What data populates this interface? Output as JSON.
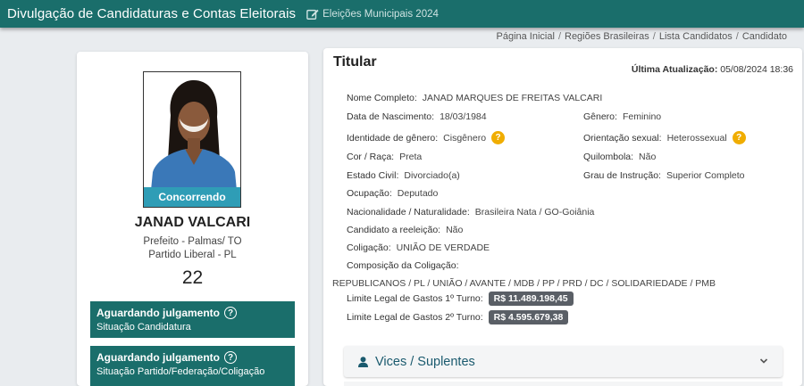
{
  "header": {
    "title": "Divulgação de Candidaturas e Contas Eleitorais",
    "election": "Eleições Municipais 2024"
  },
  "breadcrumb": [
    "Página Inicial",
    "Regiões Brasileiras",
    "Lista Candidatos",
    "Candidato"
  ],
  "candidate": {
    "photo_badge": "Concorrendo",
    "name": "JANAD VALCARI",
    "office": "Prefeito - Palmas/ TO",
    "party": "Partido Liberal - PL",
    "number": "22",
    "status": [
      {
        "title": "Aguardando julgamento",
        "subtitle": "Situação Candidatura"
      },
      {
        "title": "Aguardando julgamento",
        "subtitle": "Situação Partido/Federação/Coligação"
      }
    ]
  },
  "details": {
    "heading": "Titular",
    "updated_label": "Última Atualização:",
    "updated_value": "05/08/2024 18:36",
    "full_name": {
      "label": "Nome Completo:",
      "value": "JANAD MARQUES DE FREITAS VALCARI"
    },
    "birth": {
      "label": "Data de Nascimento:",
      "value": "18/03/1984"
    },
    "gender": {
      "label": "Gênero:",
      "value": "Feminino"
    },
    "gender_identity": {
      "label": "Identidade de gênero:",
      "value": "Cisgênero"
    },
    "sexual_orientation": {
      "label": "Orientação sexual:",
      "value": "Heterossexual"
    },
    "race": {
      "label": "Cor / Raça:",
      "value": "Preta"
    },
    "quilombola": {
      "label": "Quilombola:",
      "value": "Não"
    },
    "civil_status": {
      "label": "Estado Civil:",
      "value": "Divorciado(a)"
    },
    "education": {
      "label": "Grau de Instrução:",
      "value": "Superior Completo"
    },
    "occupation": {
      "label": "Ocupação:",
      "value": "Deputado"
    },
    "nationality": {
      "label": "Nacionalidade / Naturalidade:",
      "value": "Brasileira Nata / GO-Goiânia"
    },
    "reelection": {
      "label": "Candidato a reeleição:",
      "value": "Não"
    },
    "coalition": {
      "label": "Coligação:",
      "value": "UNIÃO DE VERDADE"
    },
    "coalition_comp": {
      "label": "Composição da Coligação:",
      "value": "REPUBLICANOS / PL / UNIÃO / AVANTE / MDB / PP / PRD / DC / SOLIDARIEDADE / PMB"
    },
    "spend_limit_1": {
      "label": "Limite Legal de Gastos 1º Turno:",
      "value": "R$ 11.489.198,45"
    },
    "spend_limit_2": {
      "label": "Limite Legal de Gastos 2º Turno:",
      "value": "R$ 4.595.679,38"
    },
    "help_glyph": "?"
  },
  "accordion": {
    "label": "Vices / Suplentes"
  },
  "colors": {
    "primary": "#1a6e6b",
    "badge": "#2f9db6",
    "warning": "#f0ad00",
    "money": "#5a5f66"
  },
  "icons": {
    "edit": "edit-icon",
    "help": "question-circle-icon",
    "user": "user-icon",
    "chevron": "chevron-down-icon"
  }
}
